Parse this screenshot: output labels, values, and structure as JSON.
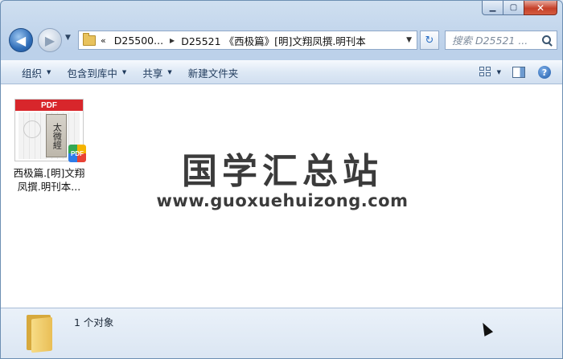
{
  "window": {
    "minimize_glyph": "▁",
    "maximize_glyph": "▢",
    "close_glyph": "✕"
  },
  "nav": {
    "back_glyph": "◀",
    "forward_glyph": "▶",
    "history_glyph": "▼"
  },
  "address": {
    "chevrons": "«",
    "segments": [
      "D25500...",
      "D25521 《西极篇》[明]文翔凤撰.明刊本"
    ],
    "separator": "▶",
    "dropdown": "▼"
  },
  "refresh_glyph": "↻",
  "search": {
    "placeholder": "搜索 D25521 ..."
  },
  "toolbar": {
    "items": [
      {
        "label": "组织",
        "has_caret": true
      },
      {
        "label": "包含到库中",
        "has_caret": true
      },
      {
        "label": "共享",
        "has_caret": true
      },
      {
        "label": "新建文件夹",
        "has_caret": false
      }
    ],
    "caret": "▼",
    "help_glyph": "?"
  },
  "file": {
    "band_label": "PDF",
    "badge_label": "PDF",
    "book_title": "太微經",
    "name": "西极篇.[明]文翔凤撰.明刊本..."
  },
  "watermark": {
    "title": "国学汇总站",
    "url": "www.guoxuehuizong.com"
  },
  "status": {
    "count": "1 个对象"
  },
  "colors": {
    "close_button": "#c5402a",
    "toolbar_text": "#1e395b",
    "pdf_red": "#d8262b",
    "watermark": "#3b3b3b"
  }
}
